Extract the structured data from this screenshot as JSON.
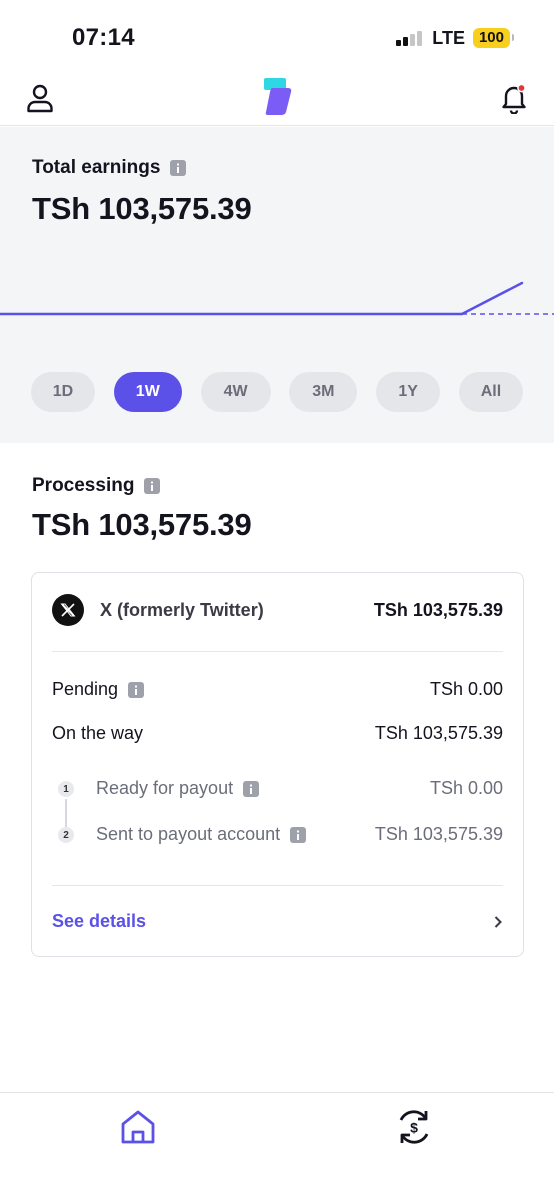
{
  "status_bar": {
    "time": "07:14",
    "network": "LTE",
    "battery": "100"
  },
  "header": {
    "profile_icon": "person-icon",
    "logo_icon": "app-logo-icon",
    "bell_icon": "bell-icon",
    "has_notification": true,
    "accent_color": "#5b51e8"
  },
  "earnings": {
    "label": "Total earnings",
    "amount": "TSh 103,575.39",
    "ranges": [
      {
        "label": "1D",
        "active": false
      },
      {
        "label": "1W",
        "active": true
      },
      {
        "label": "4W",
        "active": false
      },
      {
        "label": "3M",
        "active": false
      },
      {
        "label": "1Y",
        "active": false
      },
      {
        "label": "All",
        "active": false
      }
    ]
  },
  "processing": {
    "label": "Processing",
    "amount": "TSh 103,575.39",
    "platform": {
      "name": "X (formerly Twitter)",
      "amount": "TSh 103,575.39",
      "icon": "x-logo-icon"
    },
    "pending": {
      "label": "Pending",
      "amount": "TSh 0.00"
    },
    "on_the_way": {
      "label": "On the way",
      "amount": "TSh 103,575.39"
    },
    "steps": [
      {
        "number": "1",
        "label": "Ready for payout",
        "amount": "TSh 0.00"
      },
      {
        "number": "2",
        "label": "Sent to payout account",
        "amount": "TSh 103,575.39"
      }
    ],
    "details_link": "See details"
  },
  "bottom_nav": {
    "items": [
      {
        "icon": "home-icon",
        "active": true
      },
      {
        "icon": "payout-cycle-icon",
        "active": false
      }
    ]
  }
}
